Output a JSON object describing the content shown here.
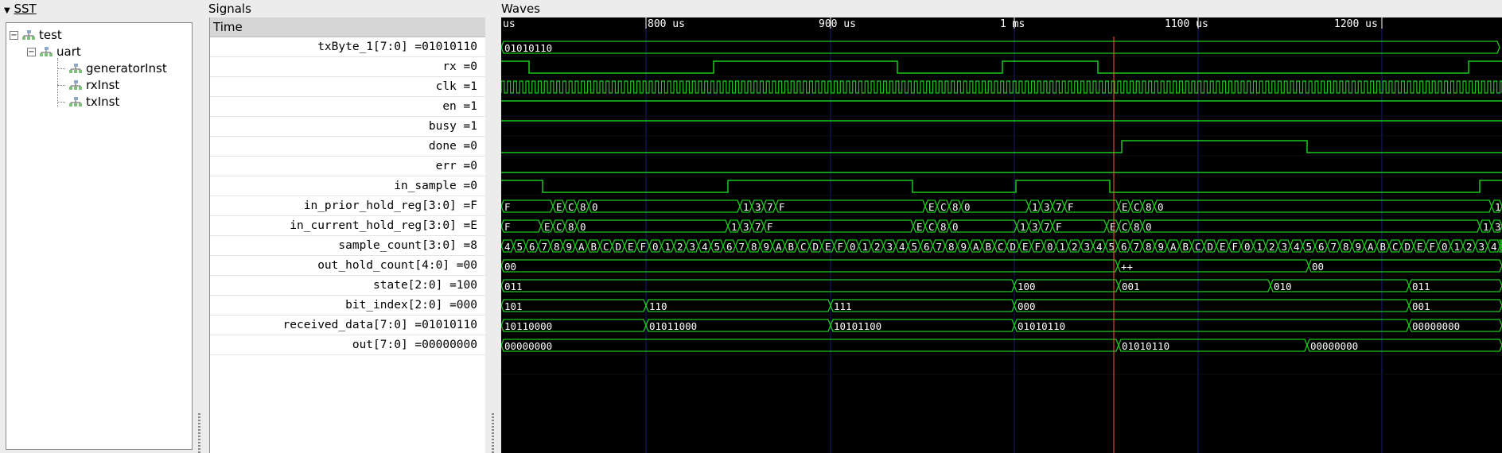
{
  "sst": {
    "title": "SST",
    "tree": [
      {
        "label": "test",
        "expanded": true,
        "depth": 0
      },
      {
        "label": "uart",
        "expanded": true,
        "depth": 1
      },
      {
        "label": "generatorInst",
        "depth": 2
      },
      {
        "label": "rxInst",
        "depth": 2
      },
      {
        "label": "txInst",
        "depth": 2
      }
    ]
  },
  "signals": {
    "title": "Signals",
    "header": "Time",
    "rows": [
      {
        "name": "txByte_1[7:0]",
        "value": "01010110"
      },
      {
        "name": "rx",
        "value": "0"
      },
      {
        "name": "clk",
        "value": "1"
      },
      {
        "name": "en",
        "value": "1"
      },
      {
        "name": "busy",
        "value": "1"
      },
      {
        "name": "done",
        "value": "0"
      },
      {
        "name": "err",
        "value": "0"
      },
      {
        "name": "in_sample",
        "value": "0"
      },
      {
        "name": "in_prior_hold_reg[3:0]",
        "value": "F"
      },
      {
        "name": "in_current_hold_reg[3:0]",
        "value": "E"
      },
      {
        "name": "sample_count[3:0]",
        "value": "8"
      },
      {
        "name": "out_hold_count[4:0]",
        "value": "00"
      },
      {
        "name": "state[2:0]",
        "value": "100"
      },
      {
        "name": "bit_index[2:0]",
        "value": "000"
      },
      {
        "name": "received_data[7:0]",
        "value": "01010110"
      },
      {
        "name": "out[7:0]",
        "value": "00000000"
      }
    ]
  },
  "waves": {
    "title": "Waves",
    "ruler_labels": [
      "us",
      "800 us",
      "900 us",
      "1 ms",
      "1100 us",
      "1200 us"
    ],
    "colors": {
      "wave": "#1ec81e",
      "background": "#000000",
      "grid": "#1c1c78",
      "marker": "#ff5a3c",
      "ruler": "#ffffff"
    }
  },
  "traces": [
    {
      "kind": "bus",
      "segs": [
        [
          0,
          1255,
          "01010110"
        ]
      ]
    },
    {
      "kind": "bit",
      "edges": [
        [
          0,
          1
        ],
        [
          35,
          0
        ],
        [
          267,
          1
        ],
        [
          498,
          0
        ],
        [
          630,
          1
        ],
        [
          750,
          0
        ],
        [
          1216,
          1
        ]
      ]
    },
    {
      "kind": "clk"
    },
    {
      "kind": "bit",
      "edges": [
        [
          0,
          1
        ]
      ]
    },
    {
      "kind": "bit",
      "edges": [
        [
          0,
          1
        ]
      ]
    },
    {
      "kind": "bit",
      "edges": [
        [
          0,
          0
        ],
        [
          780,
          1
        ],
        [
          1013,
          0
        ]
      ]
    },
    {
      "kind": "bit",
      "edges": [
        [
          0,
          0
        ]
      ]
    },
    {
      "kind": "bit",
      "edges": [
        [
          0,
          1
        ],
        [
          52,
          0
        ],
        [
          285,
          1
        ],
        [
          517,
          0
        ],
        [
          647,
          1
        ],
        [
          765,
          0
        ],
        [
          1230,
          1
        ]
      ]
    },
    {
      "kind": "bus",
      "segs": [
        [
          0,
          65,
          "F"
        ],
        [
          65,
          80,
          "E"
        ],
        [
          80,
          95,
          "C"
        ],
        [
          95,
          110,
          "8"
        ],
        [
          110,
          300,
          "0"
        ],
        [
          300,
          315,
          "1"
        ],
        [
          315,
          330,
          "3"
        ],
        [
          330,
          345,
          "7"
        ],
        [
          345,
          533,
          "F"
        ],
        [
          533,
          548,
          "E"
        ],
        [
          548,
          563,
          "C"
        ],
        [
          563,
          578,
          "8"
        ],
        [
          578,
          663,
          "0"
        ],
        [
          663,
          678,
          "1"
        ],
        [
          678,
          693,
          "3"
        ],
        [
          693,
          708,
          "7"
        ],
        [
          708,
          776,
          "F"
        ],
        [
          776,
          791,
          "E"
        ],
        [
          791,
          806,
          "C"
        ],
        [
          806,
          821,
          "8"
        ],
        [
          821,
          1245,
          "0"
        ],
        [
          1245,
          1258,
          "1"
        ]
      ]
    },
    {
      "kind": "bus",
      "segs": [
        [
          0,
          50,
          "F"
        ],
        [
          50,
          65,
          "E"
        ],
        [
          65,
          80,
          "C"
        ],
        [
          80,
          95,
          "8"
        ],
        [
          95,
          285,
          "0"
        ],
        [
          285,
          300,
          "1"
        ],
        [
          300,
          315,
          "3"
        ],
        [
          315,
          330,
          "7"
        ],
        [
          330,
          518,
          "F"
        ],
        [
          518,
          533,
          "E"
        ],
        [
          533,
          548,
          "C"
        ],
        [
          548,
          563,
          "8"
        ],
        [
          563,
          648,
          "0"
        ],
        [
          648,
          663,
          "1"
        ],
        [
          663,
          678,
          "3"
        ],
        [
          678,
          693,
          "7"
        ],
        [
          693,
          761,
          "F"
        ],
        [
          761,
          776,
          "E"
        ],
        [
          776,
          791,
          "C"
        ],
        [
          791,
          806,
          "8"
        ],
        [
          806,
          1230,
          "0"
        ],
        [
          1230,
          1245,
          "1"
        ],
        [
          1245,
          1258,
          "3"
        ]
      ]
    },
    {
      "kind": "count",
      "start": 4,
      "end": 1258
    },
    {
      "kind": "bus",
      "segs": [
        [
          0,
          775,
          "00"
        ],
        [
          775,
          1015,
          "++"
        ],
        [
          1015,
          1258,
          "00"
        ]
      ]
    },
    {
      "kind": "bus",
      "segs": [
        [
          0,
          645,
          "011"
        ],
        [
          645,
          776,
          "100"
        ],
        [
          776,
          967,
          "001"
        ],
        [
          967,
          1141,
          "010"
        ],
        [
          1141,
          1258,
          "011"
        ]
      ]
    },
    {
      "kind": "bus",
      "segs": [
        [
          0,
          182,
          "101"
        ],
        [
          182,
          414,
          "110"
        ],
        [
          414,
          645,
          "111"
        ],
        [
          645,
          1141,
          "000"
        ],
        [
          1141,
          1258,
          "001"
        ]
      ]
    },
    {
      "kind": "bus",
      "segs": [
        [
          0,
          182,
          "10110000"
        ],
        [
          182,
          414,
          "01011000"
        ],
        [
          414,
          645,
          "10101100"
        ],
        [
          645,
          1141,
          "01010110"
        ],
        [
          1141,
          1258,
          "00000000"
        ]
      ]
    },
    {
      "kind": "bus",
      "segs": [
        [
          0,
          776,
          "00000000"
        ],
        [
          776,
          1013,
          "01010110"
        ],
        [
          1013,
          1258,
          "00000000"
        ]
      ]
    }
  ]
}
